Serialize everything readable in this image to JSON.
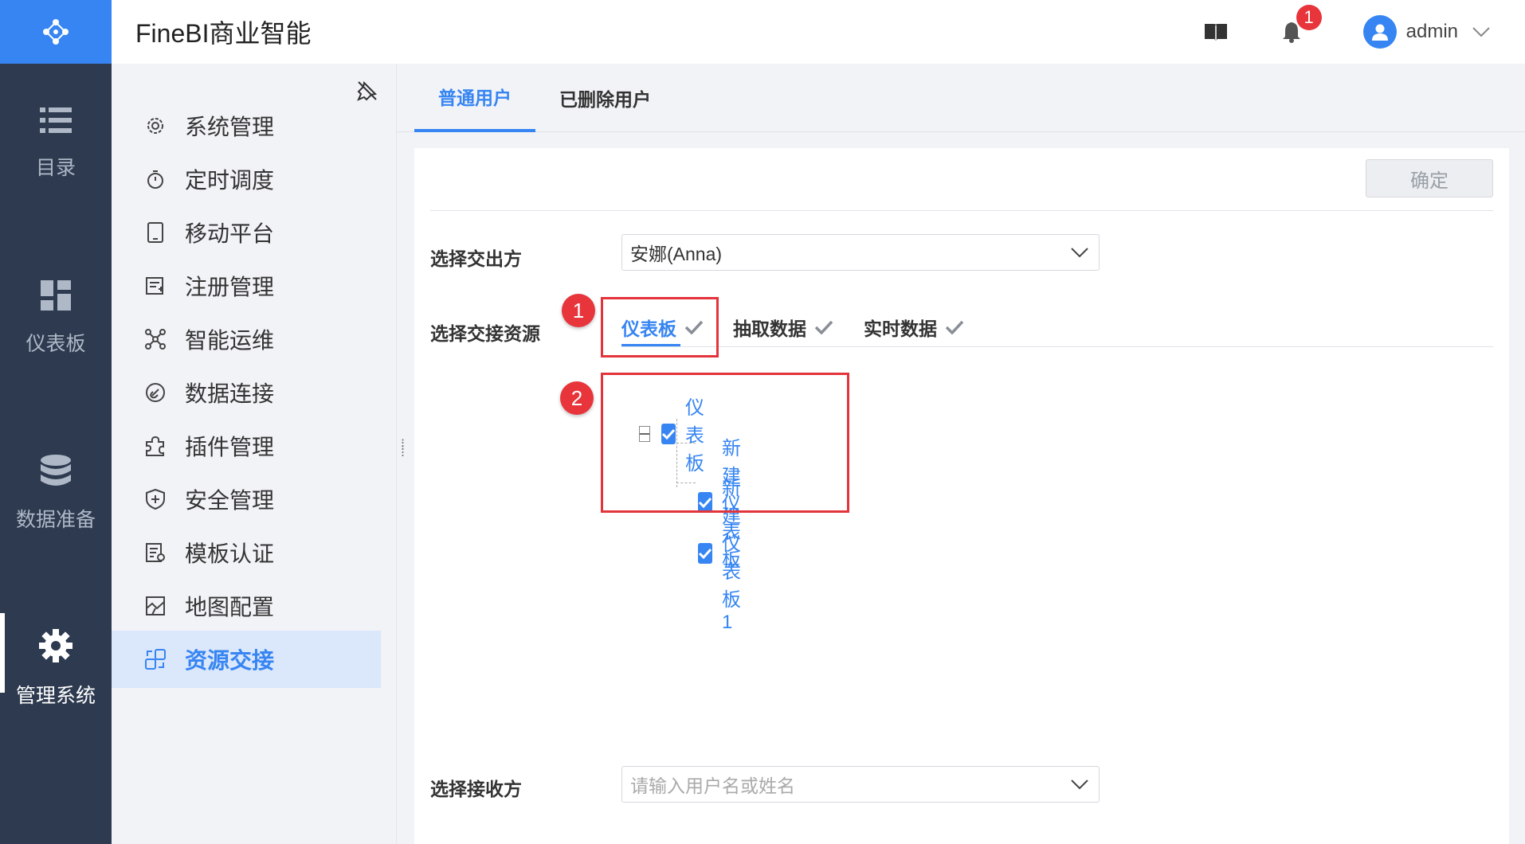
{
  "header": {
    "app_title": "FineBI商业智能",
    "notification_count": "1",
    "user_name": "admin"
  },
  "leftnav": {
    "items": [
      {
        "label": "目录"
      },
      {
        "label": "仪表板"
      },
      {
        "label": "数据准备"
      },
      {
        "label": "管理系统"
      }
    ]
  },
  "sidebar": {
    "items": [
      {
        "label": "系统管理"
      },
      {
        "label": "定时调度"
      },
      {
        "label": "移动平台"
      },
      {
        "label": "注册管理"
      },
      {
        "label": "智能运维"
      },
      {
        "label": "数据连接"
      },
      {
        "label": "插件管理"
      },
      {
        "label": "安全管理"
      },
      {
        "label": "模板认证"
      },
      {
        "label": "地图配置"
      },
      {
        "label": "资源交接"
      }
    ]
  },
  "tabs": [
    {
      "label": "普通用户"
    },
    {
      "label": "已删除用户"
    }
  ],
  "main": {
    "confirm_label": "确定",
    "from_label": "选择交出方",
    "from_value": "安娜(Anna)",
    "resource_label": "选择交接资源",
    "resource_tabs": [
      {
        "label": "仪表板"
      },
      {
        "label": "抽取数据"
      },
      {
        "label": "实时数据"
      }
    ],
    "tree": {
      "root": "仪表板",
      "children": [
        "新建仪表板",
        "新建仪表板1"
      ]
    },
    "to_label": "选择接收方",
    "to_placeholder": "请输入用户名或姓名"
  },
  "annotations": [
    "1",
    "2"
  ],
  "colors": {
    "accent": "#3685f2",
    "nav_bg": "#2d3a4f",
    "annotation_red": "#e3343b"
  }
}
